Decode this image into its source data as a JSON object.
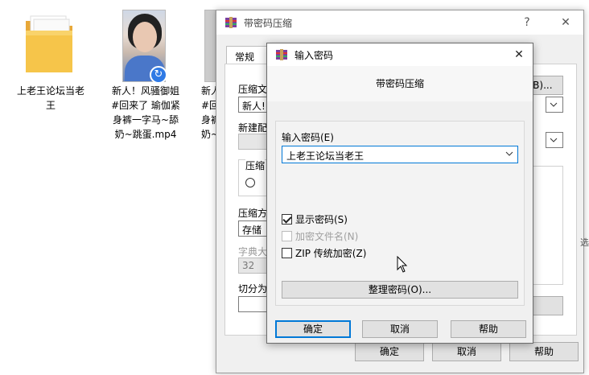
{
  "desktop": {
    "folder_label": "上老王论坛当老王",
    "video_label": "新人！风骚御姐#回来了 瑜伽紧身裤一字马~舔奶~跳蛋.mp4",
    "video2_label": "新人\n#回\n身裤\n奶~"
  },
  "back_window": {
    "title": "带密码压缩",
    "help_btn": "?",
    "close_btn": "✕",
    "tab_general": "常规",
    "label_archive": "压缩文",
    "archive_value": "新人!",
    "browse_btn": "(B)...",
    "label_profile": "新建配",
    "label_format": "压缩",
    "label_method": "压缩方",
    "method_value": "存储",
    "label_dict": "字典大",
    "dict_value": "32",
    "label_split": "切分为",
    "side_char": "选",
    "ok_btn": "确定",
    "cancel_btn": "取消",
    "help_button": "帮助"
  },
  "dialog": {
    "title": "输入密码",
    "header": "带密码压缩",
    "password_label": "输入密码(E)",
    "password_value": "上老王论坛当老王",
    "show_password": "显示密码(S)",
    "encrypt_names": "加密文件名(N)",
    "zip_legacy": "ZIP 传统加密(Z)",
    "organize_btn": "整理密码(O)...",
    "ok_btn": "确定",
    "cancel_btn": "取消",
    "help_btn": "帮助",
    "close_btn": "✕"
  },
  "state": {
    "show_password_checked": true,
    "encrypt_names_checked": false,
    "zip_legacy_checked": false
  },
  "colors": {
    "accent": "#0078d7",
    "folder": "#f6c54a",
    "badge": "#2f7ae5"
  }
}
